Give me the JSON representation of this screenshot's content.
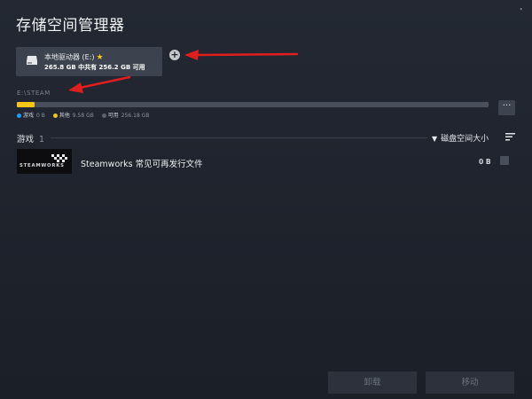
{
  "window": {
    "title": "存储空间管理器",
    "close_symbol": "⋅"
  },
  "drive": {
    "name": "本地驱动器 (E:)",
    "star_symbol": "★",
    "space_text": "265.8 GB 中共有 256.2 GB 可用",
    "icon": "hard-drive-icon",
    "add_symbol": "+"
  },
  "storage": {
    "path": "E:\\STEAM",
    "used_fraction": 0.037,
    "more_symbol": "···",
    "legend": [
      {
        "label": "游戏",
        "value": "0 B",
        "color": "#1a9fff"
      },
      {
        "label": "其他",
        "value": "9.58 GB",
        "color": "#f5c518"
      },
      {
        "label": "可用",
        "value": "256.18 GB",
        "color": "#5c6370"
      }
    ]
  },
  "games": {
    "label": "游戏",
    "count": "1",
    "sort_arrow": "▼",
    "sort_label": "磁盘空间大小",
    "items": [
      {
        "name": "Steamworks 常见可再发行文件",
        "size": "0 B",
        "thumb_text": "STEAMWORKS"
      }
    ]
  },
  "actions": {
    "uninstall": "卸载",
    "move": "移动"
  },
  "colors": {
    "accent_yellow": "#f5c518",
    "annotation_red": "#e01e1e"
  }
}
